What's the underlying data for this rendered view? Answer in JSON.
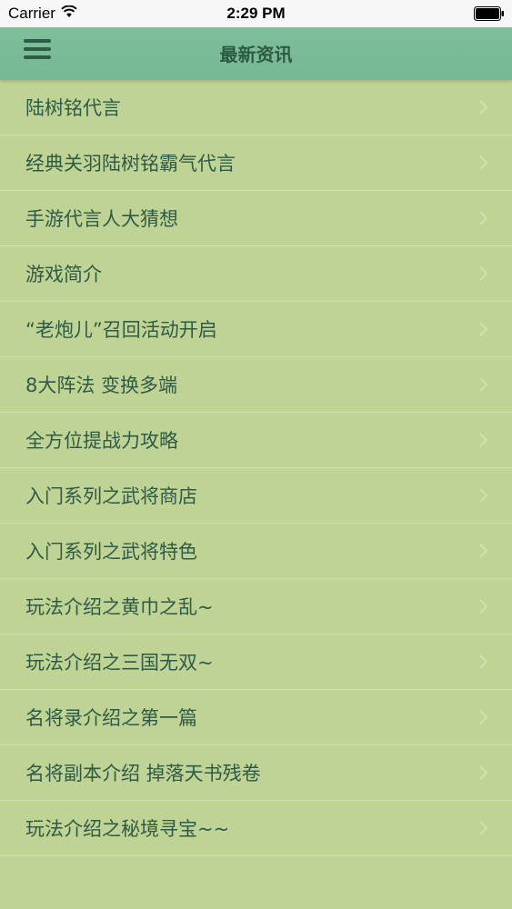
{
  "status_bar": {
    "carrier": "Carrier",
    "time": "2:29 PM"
  },
  "nav": {
    "title": "最新资讯"
  },
  "news_items": [
    "陆树铭代言",
    "经典关羽陆树铭霸气代言",
    "手游代言人大猜想",
    "游戏简介",
    "“老炮儿”召回活动开启",
    "8大阵法 变换多端",
    "全方位提战力攻略",
    "入门系列之武将商店",
    "入门系列之武将特色",
    "玩法介绍之黄巾之乱~",
    "玩法介绍之三国无双~",
    "名将录介绍之第一篇",
    "名将副本介绍 掉落天书残卷",
    "玩法介绍之秘境寻宝~~"
  ],
  "colors": {
    "background": "#bfd494",
    "nav_bar": "#7fbf9a",
    "text": "#2f5a48"
  },
  "icons": {
    "menu": "hamburger-menu-icon",
    "row_accessory": "chevron-right-icon",
    "wifi": "wifi-icon",
    "battery": "battery-icon"
  }
}
